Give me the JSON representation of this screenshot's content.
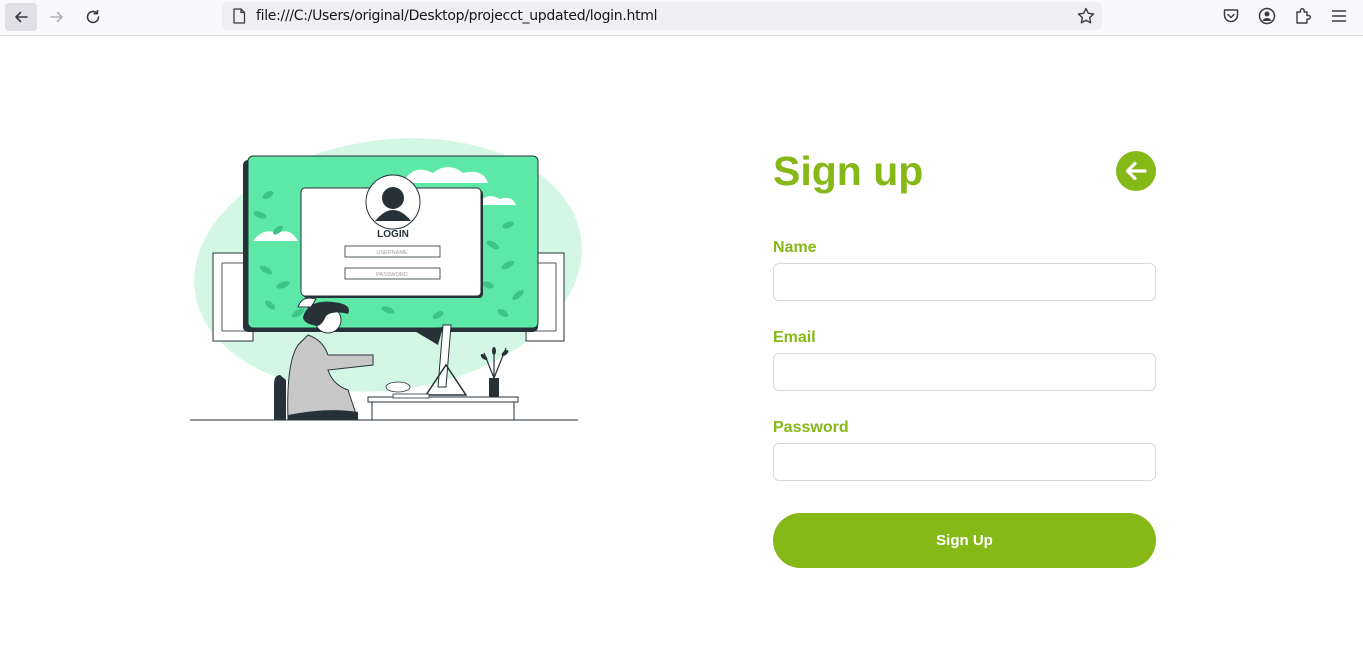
{
  "browser": {
    "url": "file:///C:/Users/original/Desktop/projecct_updated/login.html",
    "icons": [
      "back-arrow-icon",
      "forward-arrow-icon",
      "reload-icon",
      "page-icon",
      "bookmark-star-icon",
      "pocket-icon",
      "account-icon",
      "extensions-icon",
      "menu-icon"
    ]
  },
  "illustration": {
    "login_title": "LOGIN",
    "username_placeholder": "USERNAME",
    "password_placeholder": "PASSWORD"
  },
  "form": {
    "title": "Sign up",
    "name_label": "Name",
    "email_label": "Email",
    "password_label": "Password",
    "submit_label": "Sign Up",
    "name_value": "",
    "email_value": "",
    "password_value": ""
  },
  "colors": {
    "accent": "#86b817",
    "illustration_green": "#5ee8a8",
    "illustration_light": "#d4f7e5",
    "dark": "#263238"
  }
}
